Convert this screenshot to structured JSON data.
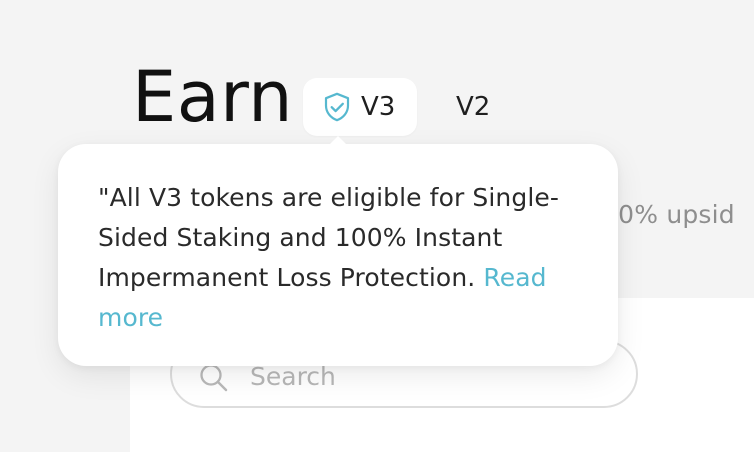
{
  "page": {
    "title": "Earn",
    "subtitle_fragment": "00% upsid"
  },
  "version_switch": {
    "tabs": [
      {
        "label": "V3",
        "icon": "shield-check-icon",
        "active": true
      },
      {
        "label": "V2",
        "active": false
      }
    ]
  },
  "tooltip": {
    "text": "\"All V3 tokens are eligible for Single-Sided Staking and 100% Instant Impermanent Loss Protection. ",
    "link_label": "Read more"
  },
  "search": {
    "placeholder": "Search",
    "value": ""
  },
  "colors": {
    "accent": "#56b8cf",
    "text": "#1f1f1f",
    "muted": "#8e8e8e",
    "background": "#f4f4f4"
  }
}
